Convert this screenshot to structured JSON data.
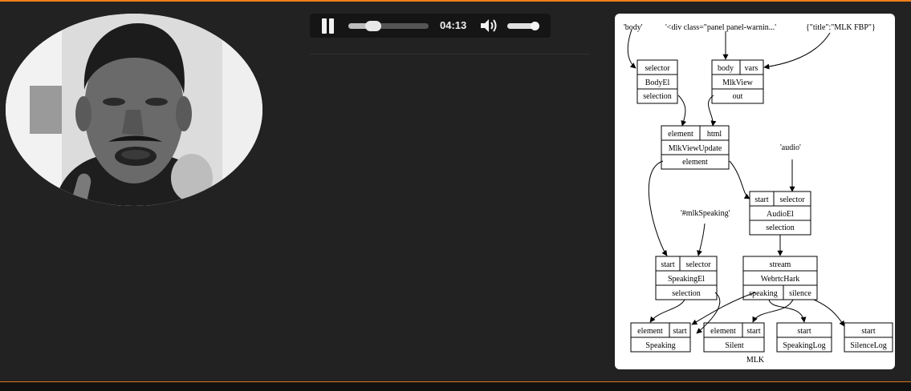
{
  "player": {
    "time": "04:13",
    "progress": 0.31,
    "volume": 0.85,
    "state": "playing"
  },
  "graph": {
    "title": "MLK",
    "inputs": [
      {
        "id": "in_body",
        "label": "'body'"
      },
      {
        "id": "in_div",
        "label": "'<div class=\"panel panel-warnin...'"
      },
      {
        "id": "in_title",
        "label": "{\"title\":\"MLK FBP\"}"
      },
      {
        "id": "in_audio",
        "label": "'audio'"
      },
      {
        "id": "in_mlk",
        "label": "'#mlkSpeaking'"
      }
    ],
    "nodes": [
      {
        "id": "BodyEl",
        "name": "BodyEl",
        "inports": [
          "selector"
        ],
        "outports": [
          "selection"
        ]
      },
      {
        "id": "MlkView",
        "name": "MlkView",
        "inports": [
          "body",
          "vars"
        ],
        "outports": [
          "out"
        ]
      },
      {
        "id": "MlkViewUpdate",
        "name": "MlkViewUpdate",
        "inports": [
          "element",
          "html"
        ],
        "outports": [
          "element"
        ]
      },
      {
        "id": "AudioEl",
        "name": "AudioEl",
        "inports": [
          "start",
          "selector"
        ],
        "outports": [
          "selection"
        ]
      },
      {
        "id": "SpeakingEl",
        "name": "SpeakingEl",
        "inports": [
          "start",
          "selector"
        ],
        "outports": [
          "selection"
        ]
      },
      {
        "id": "WebrtcHark",
        "name": "WebrtcHark",
        "inports": [
          "stream"
        ],
        "outports": [
          "speaking",
          "silence"
        ]
      },
      {
        "id": "Speaking",
        "name": "Speaking",
        "inports": [
          "element",
          "start"
        ],
        "outports": []
      },
      {
        "id": "Silent",
        "name": "Silent",
        "inports": [
          "element",
          "start"
        ],
        "outports": []
      },
      {
        "id": "SpeakingLog",
        "name": "SpeakingLog",
        "inports": [
          "start"
        ],
        "outports": []
      },
      {
        "id": "SilenceLog",
        "name": "SilenceLog",
        "inports": [
          "start"
        ],
        "outports": []
      }
    ],
    "edges": [
      {
        "from": "in_body",
        "to": "BodyEl.selector"
      },
      {
        "from": "in_div",
        "to": "MlkView.body"
      },
      {
        "from": "in_title",
        "to": "MlkView.vars"
      },
      {
        "from": "BodyEl.selection",
        "to": "MlkViewUpdate.element"
      },
      {
        "from": "MlkView.out",
        "to": "MlkViewUpdate.html"
      },
      {
        "from": "MlkViewUpdate.element",
        "to": "AudioEl.start"
      },
      {
        "from": "MlkViewUpdate.element",
        "to": "SpeakingEl.start"
      },
      {
        "from": "in_audio",
        "to": "AudioEl.selector"
      },
      {
        "from": "in_mlk",
        "to": "SpeakingEl.selector"
      },
      {
        "from": "AudioEl.selection",
        "to": "WebrtcHark.stream"
      },
      {
        "from": "SpeakingEl.selection",
        "to": "Speaking.element"
      },
      {
        "from": "SpeakingEl.selection",
        "to": "Silent.element"
      },
      {
        "from": "WebrtcHark.speaking",
        "to": "Speaking.start"
      },
      {
        "from": "WebrtcHark.speaking",
        "to": "SpeakingLog.start"
      },
      {
        "from": "WebrtcHark.silence",
        "to": "Silent.start"
      },
      {
        "from": "WebrtcHark.silence",
        "to": "SilenceLog.start"
      }
    ]
  }
}
